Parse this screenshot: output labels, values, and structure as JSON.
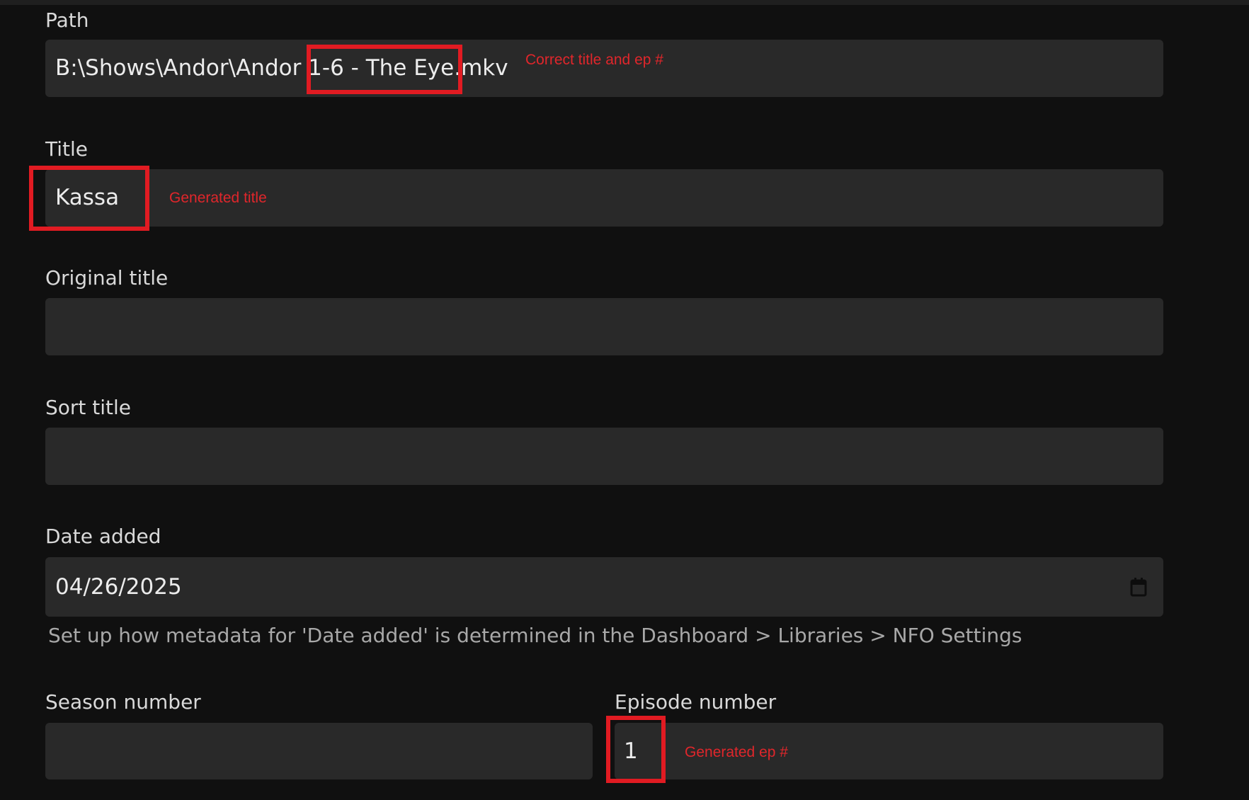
{
  "form": {
    "path": {
      "label": "Path",
      "value": "B:\\Shows\\Andor\\Andor 1-6 - The Eye.mkv",
      "annotation": "Correct title and ep #"
    },
    "title": {
      "label": "Title",
      "value": "Kassa",
      "annotation": "Generated title"
    },
    "original_title": {
      "label": "Original title",
      "value": ""
    },
    "sort_title": {
      "label": "Sort title",
      "value": ""
    },
    "date_added": {
      "label": "Date added",
      "value": "04/26/2025",
      "icon": "calendar-icon",
      "helper": "Set up how metadata for 'Date added' is determined in the Dashboard > Libraries > NFO Settings"
    },
    "season_number": {
      "label": "Season number",
      "value": ""
    },
    "episode_number": {
      "label": "Episode number",
      "value": "1",
      "annotation": "Generated ep #"
    }
  },
  "colors": {
    "background": "#101010",
    "input_background": "#292929",
    "annotation_red": "#e11b22"
  }
}
